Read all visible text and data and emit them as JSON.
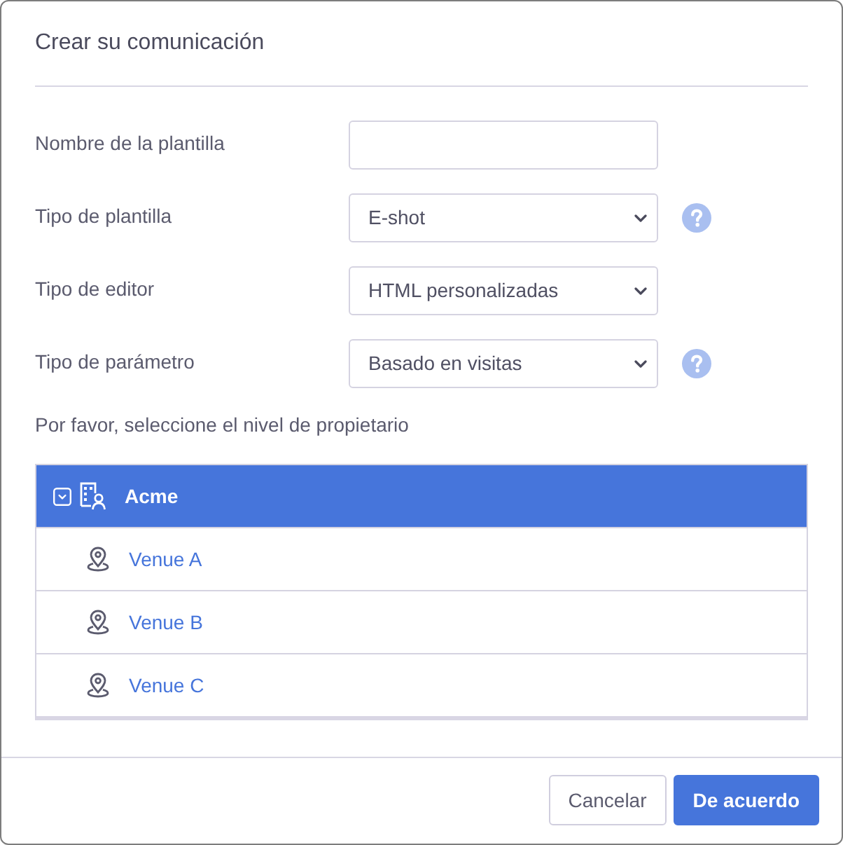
{
  "dialog": {
    "title": "Crear su comunicación"
  },
  "fields": [
    {
      "kind": "text",
      "label": "Nombre de la plantilla",
      "help": false
    },
    {
      "kind": "select",
      "label": "Tipo de plantilla",
      "value": "E-shot",
      "help": true
    },
    {
      "kind": "select",
      "label": "Tipo de editor",
      "value": "HTML personalizadas",
      "help": false
    },
    {
      "kind": "select",
      "label": "Tipo de parámetro",
      "value": "Basado en visitas",
      "help": true
    }
  ],
  "owner_level": {
    "prompt": "Por favor, seleccione el nivel de propietario",
    "tree": [
      {
        "kind": "organization",
        "label": "Acme",
        "expanded": true,
        "selected": true,
        "children": [
          {
            "kind": "venue",
            "label": "Venue A",
            "selected": false
          },
          {
            "kind": "venue",
            "label": "Venue B",
            "selected": false
          },
          {
            "kind": "venue",
            "label": "Venue C",
            "selected": false
          }
        ]
      }
    ]
  },
  "buttons": [
    {
      "kind": "secondary",
      "label": "Cancelar"
    },
    {
      "kind": "primary",
      "label": "De acuerdo"
    }
  ]
}
